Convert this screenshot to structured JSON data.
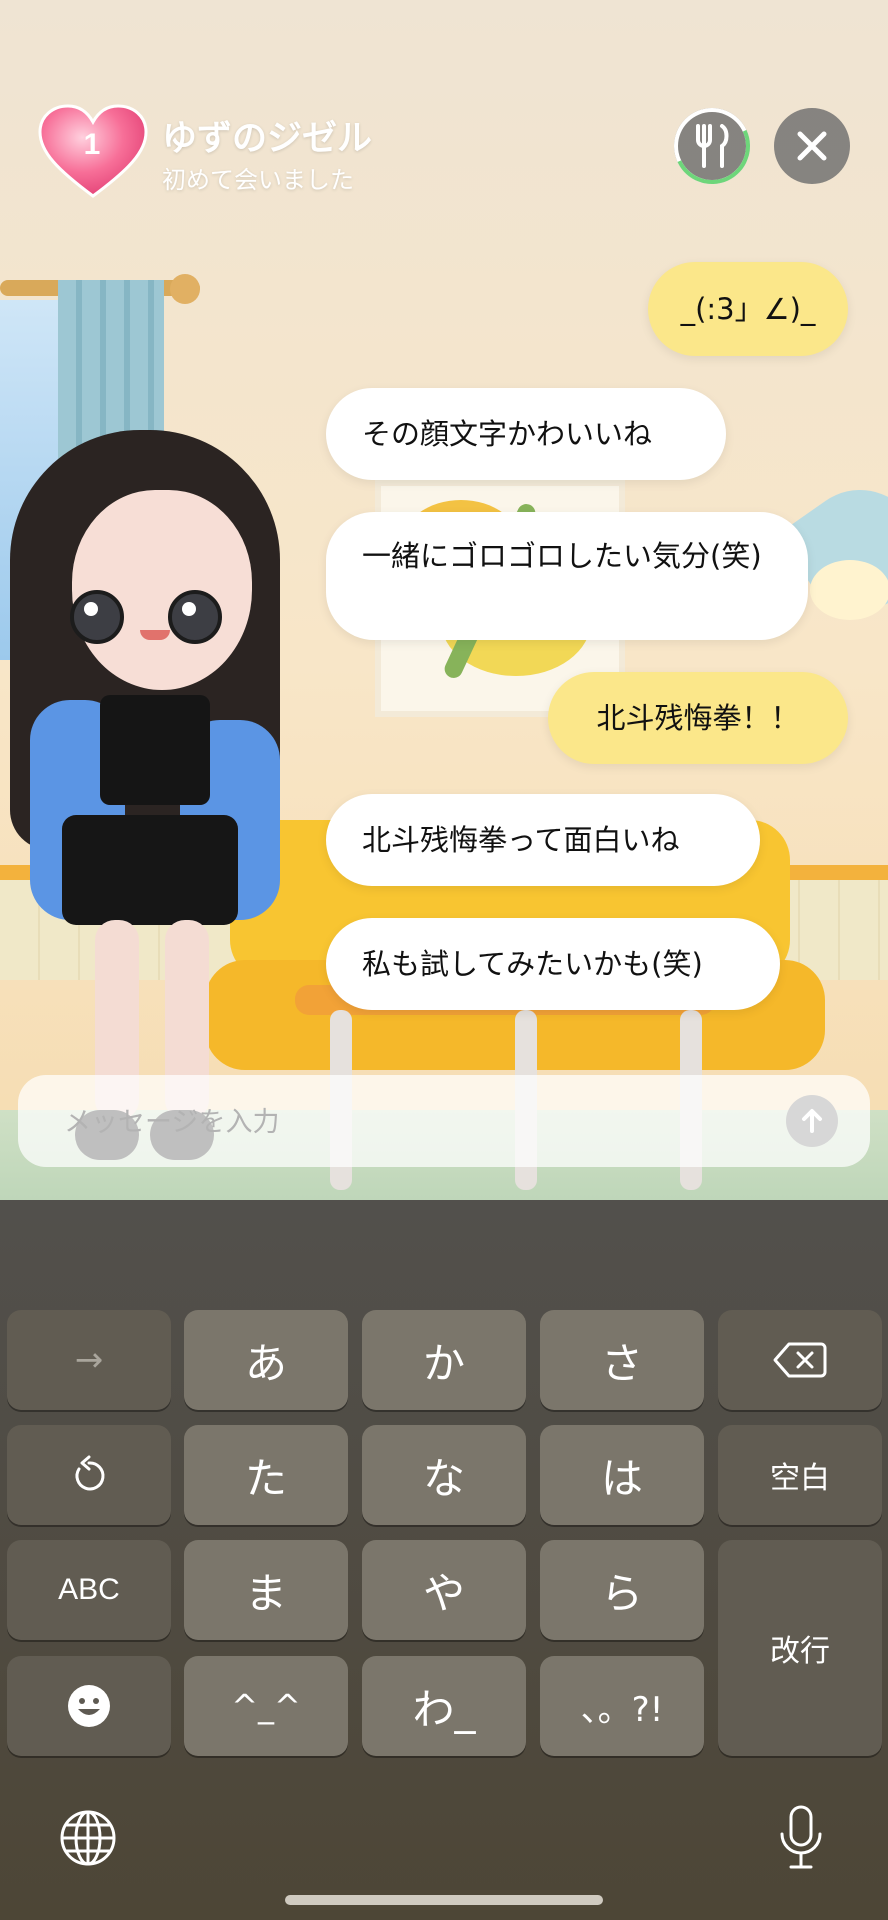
{
  "header": {
    "level": "1",
    "name": "ゆずのジゼル",
    "status": "初めて会いました",
    "food_icon": "fork-knife-icon",
    "close_icon": "close-icon"
  },
  "messages": [
    {
      "role": "user",
      "text": "_(:3」∠)_"
    },
    {
      "role": "bot",
      "text": "その顔文字かわいいね"
    },
    {
      "role": "bot",
      "text": "一緒にゴロゴロしたい気分(笑)"
    },
    {
      "role": "user",
      "text": "北斗残悔拳！！"
    },
    {
      "role": "bot",
      "text": "北斗残悔拳って面白いね"
    },
    {
      "role": "bot",
      "text": "私も試してみたいかも(笑)"
    }
  ],
  "input": {
    "placeholder": "メッセージを入力",
    "value": "",
    "send_icon": "arrow-up-icon"
  },
  "keyboard": {
    "keys": {
      "next": "→",
      "a": "あ",
      "ka": "か",
      "sa": "さ",
      "undo": "↺",
      "ta": "た",
      "na": "な",
      "ha": "は",
      "space": "空白",
      "abc": "ABC",
      "ma": "ま",
      "ya": "や",
      "ra": "ら",
      "enter": "改行",
      "emoticon": "^_^",
      "wa": "わ_",
      "punct": "、。?!"
    },
    "icons": [
      "backspace-icon",
      "undo-icon",
      "emoji-icon",
      "globe-icon",
      "microphone-icon"
    ]
  }
}
